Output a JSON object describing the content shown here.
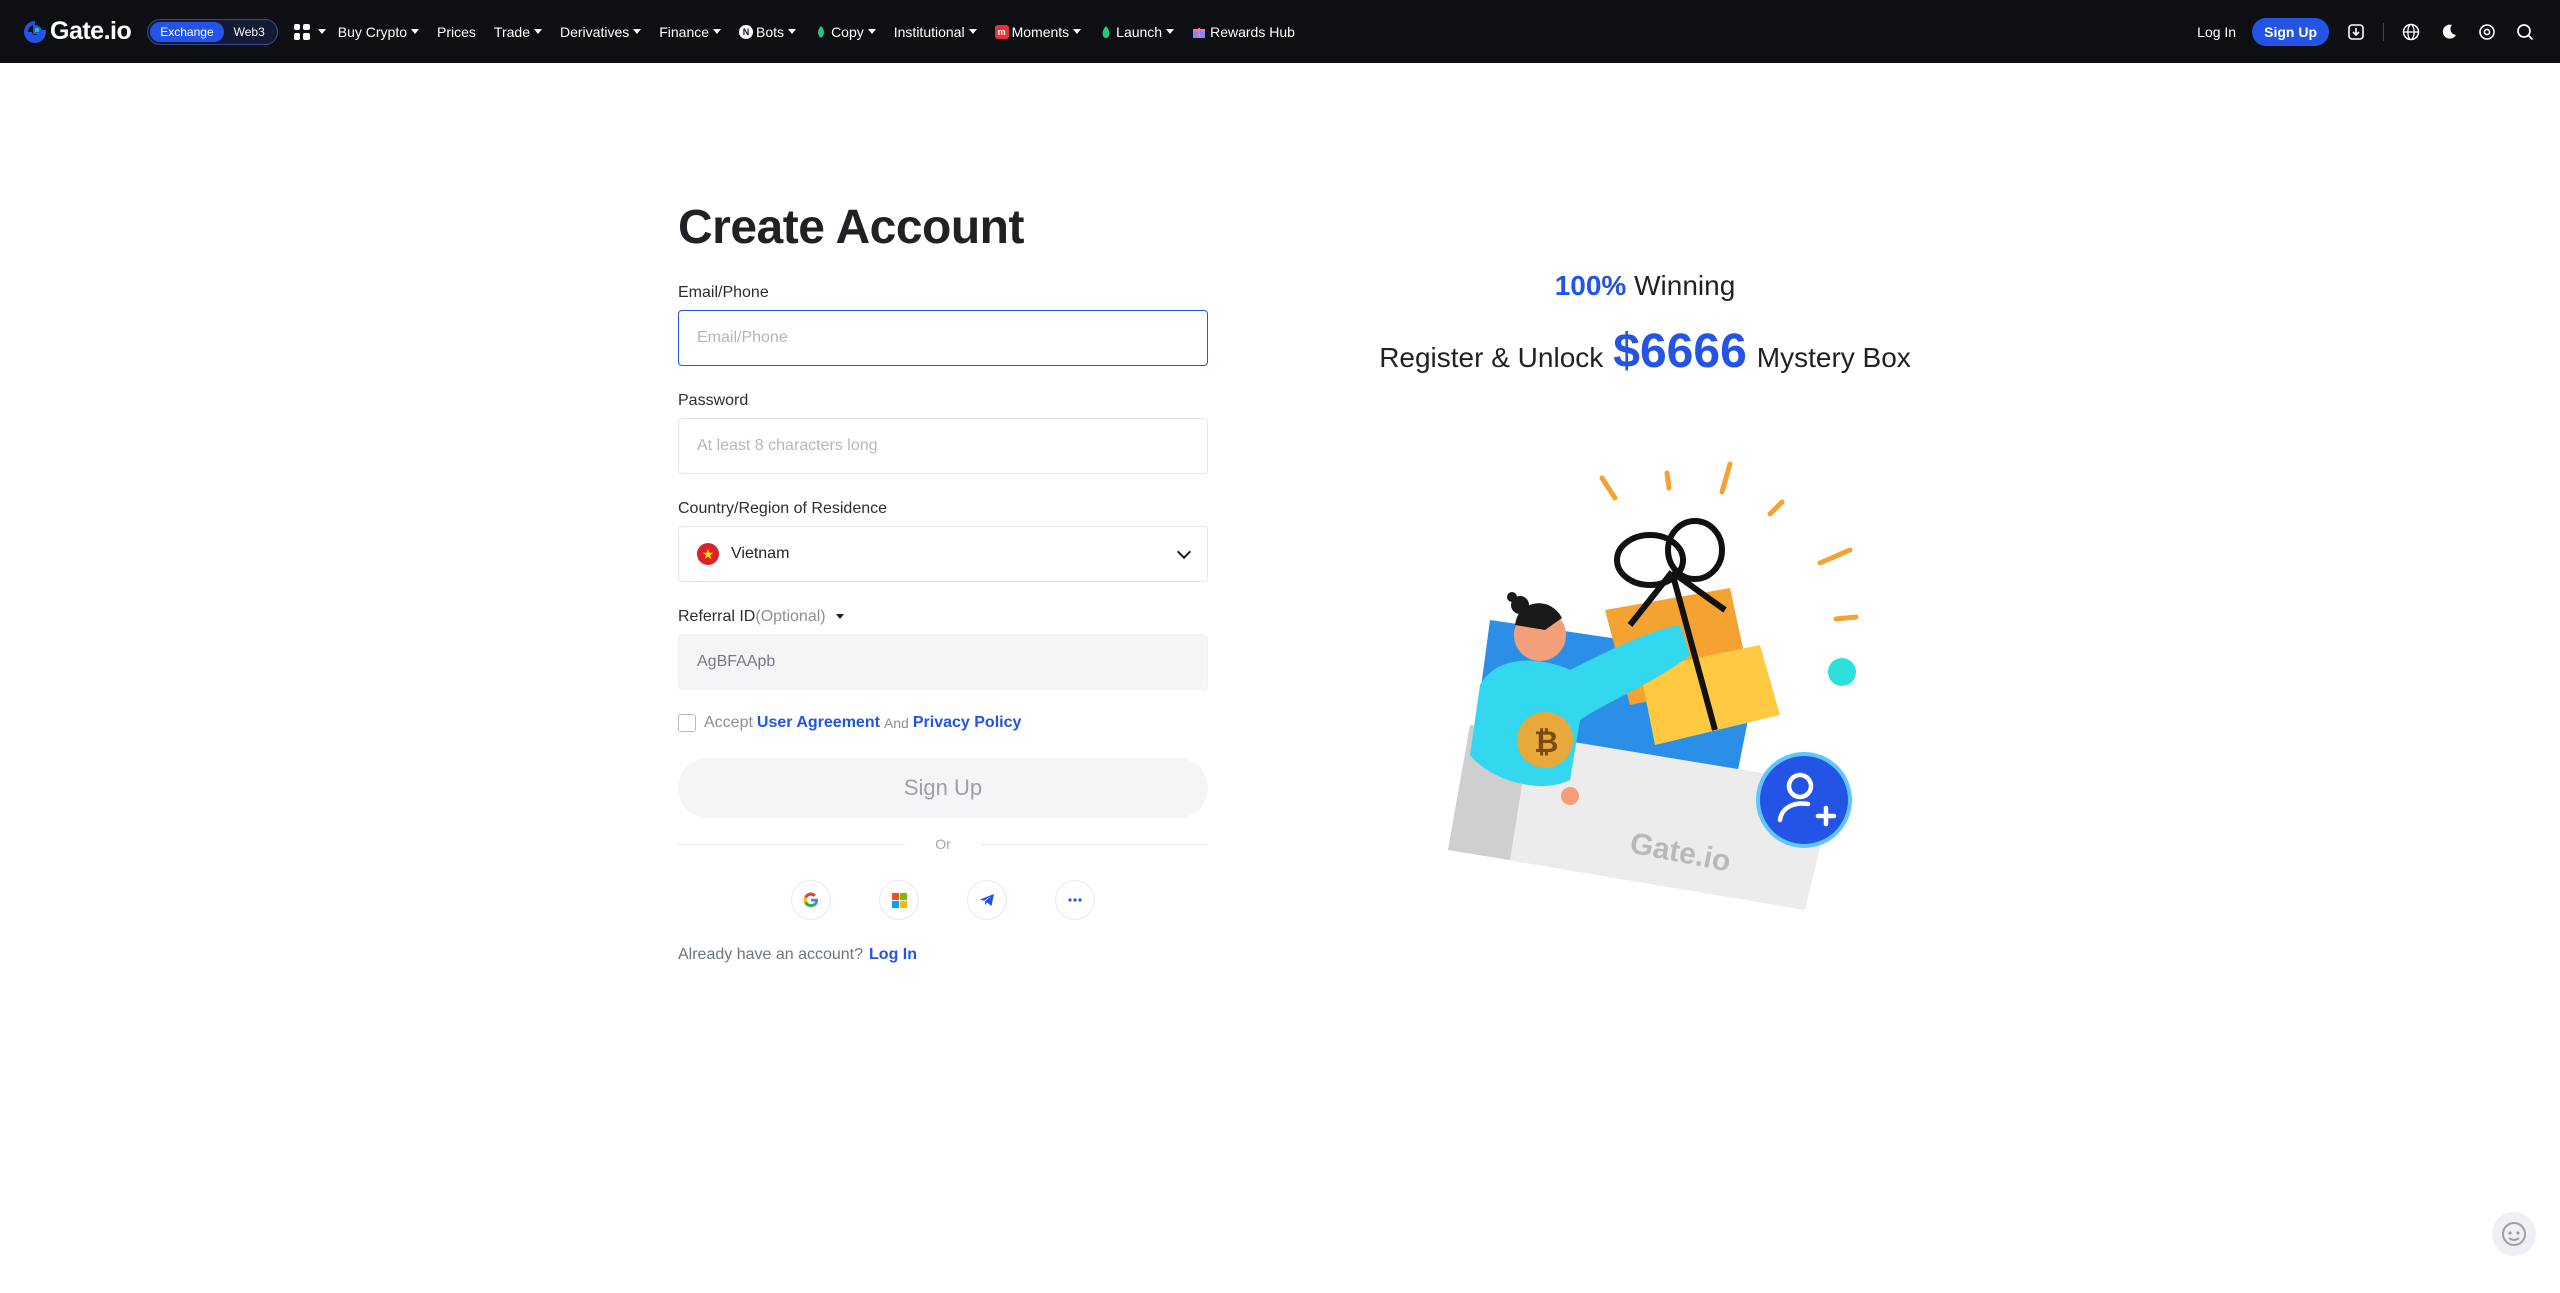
{
  "header": {
    "logo_text": "Gate.io",
    "switch": [
      "Exchange",
      "Web3"
    ],
    "nav": [
      {
        "label": "Buy Crypto",
        "dropdown": true
      },
      {
        "label": "Prices",
        "dropdown": false
      },
      {
        "label": "Trade",
        "dropdown": true
      },
      {
        "label": "Derivatives",
        "dropdown": true
      },
      {
        "label": "Finance",
        "dropdown": true
      },
      {
        "label": "Bots",
        "dropdown": true
      },
      {
        "label": "Copy",
        "dropdown": true
      },
      {
        "label": "Institutional",
        "dropdown": true
      },
      {
        "label": "Moments",
        "dropdown": true
      },
      {
        "label": "Launch",
        "dropdown": true
      },
      {
        "label": "Rewards Hub",
        "dropdown": false
      }
    ],
    "login": "Log In",
    "signup": "Sign Up",
    "icons": [
      "download-icon",
      "globe-icon",
      "moon-icon",
      "settings-icon",
      "search-icon"
    ]
  },
  "form": {
    "title": "Create Account",
    "email_label": "Email/Phone",
    "email_placeholder": "Email/Phone",
    "password_label": "Password",
    "password_placeholder": "At least 8 characters long",
    "country_label": "Country/Region of Residence",
    "country_value": "Vietnam",
    "referral_label": "Referral ID",
    "referral_optional": "(Optional)",
    "referral_value": "AgBFAApb",
    "accept": "Accept",
    "user_agreement": "User Agreement",
    "and": "And",
    "privacy_policy": "Privacy Policy",
    "signup_button": "Sign Up",
    "or": "Or",
    "social": [
      "google-icon",
      "microsoft-icon",
      "telegram-icon",
      "more-icon"
    ],
    "already": "Already have an account?",
    "login_link": "Log In"
  },
  "promo": {
    "percent": "100%",
    "winning": "Winning",
    "register": "Register & Unlock",
    "amount": "$6666",
    "box": "Mystery Box",
    "illustration_brand": "Gate.io"
  },
  "colors": {
    "accent": "#2354e6",
    "header_bg": "#0e0f12"
  }
}
